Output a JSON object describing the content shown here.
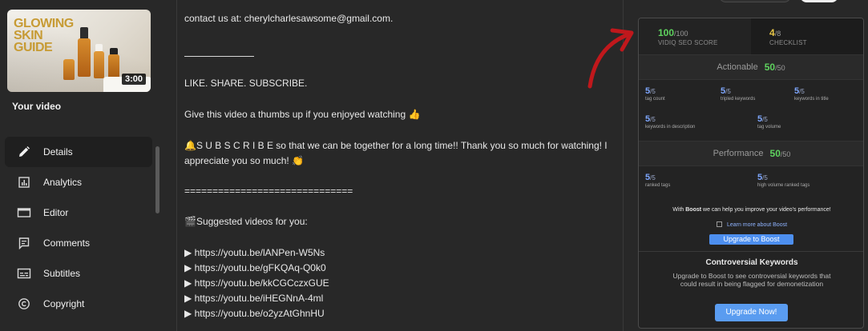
{
  "video": {
    "thumbnail_title": "GLOWING SKIN GUIDE",
    "duration": "3:00",
    "your_video_label": "Your video"
  },
  "nav": {
    "items": [
      {
        "label": "Details",
        "icon": "pencil-icon",
        "active": true
      },
      {
        "label": "Analytics",
        "icon": "analytics-icon",
        "active": false
      },
      {
        "label": "Editor",
        "icon": "editor-icon",
        "active": false
      },
      {
        "label": "Comments",
        "icon": "comments-icon",
        "active": false
      },
      {
        "label": "Subtitles",
        "icon": "subtitles-icon",
        "active": false
      },
      {
        "label": "Copyright",
        "icon": "copyright-icon",
        "active": false
      }
    ]
  },
  "description": {
    "line_contact": "contact us at: cherylcharlesawsome@gmail.com.",
    "line_like": "LIKE. SHARE. SUBSCRIBE.",
    "line_thumbs": "Give this video a thumbs up if you enjoyed watching 👍",
    "line_subscribe": "🔔S U B S C R I B E so that we can be together for a long time!! Thank you so much for watching! I appreciate you so much! 👏",
    "line_equals": "==============================",
    "line_suggested": "🎬Suggested videos for you:",
    "links": [
      "▶ https://youtu.be/lANPen-W5Ns",
      "▶ https://youtu.be/gFKQAq-Q0k0",
      "▶ https://youtu.be/kkCGCczxGUE",
      "▶ https://youtu.be/iHEGNnA-4ml",
      "▶ https://youtu.be/o2yzAtGhnHU"
    ]
  },
  "vidiq": {
    "seo_score": "100",
    "seo_score_den": "/100",
    "seo_label": "VIDIQ SEO SCORE",
    "checklist_score": "4",
    "checklist_den": "/8",
    "checklist_label": "CHECKLIST",
    "actionable_label": "Actionable",
    "actionable_value": "50",
    "actionable_den": "/50",
    "actionable_metrics": [
      {
        "value": "5",
        "den": "/5",
        "label": "tag count"
      },
      {
        "value": "5",
        "den": "/5",
        "label": "tripled keywords"
      },
      {
        "value": "5",
        "den": "/5",
        "label": "keywords in title"
      },
      {
        "value": "5",
        "den": "/5",
        "label": "keywords in description"
      },
      {
        "value": "5",
        "den": "/5",
        "label": "tag volume"
      }
    ],
    "performance_label": "Performance",
    "performance_value": "50",
    "performance_den": "/50",
    "performance_metrics": [
      {
        "value": "5",
        "den": "/5",
        "label": "ranked tags"
      },
      {
        "value": "5",
        "den": "/5",
        "label": "high volume ranked tags"
      }
    ],
    "boost_text_pre": "With ",
    "boost_text_bold": "Boost",
    "boost_text_post": " we can help you improve your video's performance!",
    "learn_more": "Learn more about Boost",
    "upgrade_boost": "Upgrade to Boost",
    "controversial_title": "Controversial Keywords",
    "controversial_desc": "Upgrade to Boost to see controversial keywords that could result in being flagged for demonetization",
    "upgrade_now": "Upgrade Now!"
  },
  "colors": {
    "background": "#282828",
    "panel": "#232323",
    "green": "#5fd35f",
    "yellow": "#e6c547",
    "blue_metric": "#7ea7ff",
    "button_blue": "#4d8fef",
    "arrow_red": "#c0181c"
  }
}
